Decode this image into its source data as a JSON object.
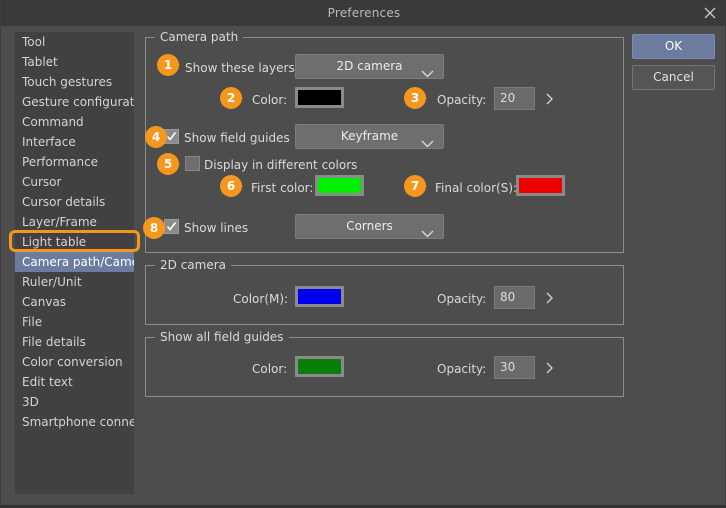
{
  "window": {
    "title": "Preferences",
    "close_icon": "close-icon"
  },
  "buttons": {
    "ok": "OK",
    "cancel": "Cancel"
  },
  "sidebar": {
    "items": [
      {
        "label": "Tool",
        "selected": false
      },
      {
        "label": "Tablet",
        "selected": false
      },
      {
        "label": "Touch gestures",
        "selected": false
      },
      {
        "label": "Gesture configuration",
        "selected": false
      },
      {
        "label": "Command",
        "selected": false
      },
      {
        "label": "Interface",
        "selected": false
      },
      {
        "label": "Performance",
        "selected": false
      },
      {
        "label": "Cursor",
        "selected": false
      },
      {
        "label": "Cursor details",
        "selected": false
      },
      {
        "label": "Layer/Frame",
        "selected": false
      },
      {
        "label": "Light table",
        "selected": false
      },
      {
        "label": "Camera path/Camera",
        "selected": true
      },
      {
        "label": "Ruler/Unit",
        "selected": false
      },
      {
        "label": "Canvas",
        "selected": false
      },
      {
        "label": "File",
        "selected": false
      },
      {
        "label": "File details",
        "selected": false
      },
      {
        "label": "Color conversion",
        "selected": false
      },
      {
        "label": "Edit text",
        "selected": false
      },
      {
        "label": "3D",
        "selected": false
      },
      {
        "label": "Smartphone connection",
        "selected": false
      }
    ],
    "highlight_color": "#f5971d"
  },
  "camera_path": {
    "group_title": "Camera path",
    "show_layers_label": "Show these layers:",
    "show_layers_value": "2D camera",
    "color_label": "Color:",
    "color_value": "#000000",
    "opacity_label": "Opacity:",
    "opacity_value": "20",
    "show_field_guides_label": "Show field guides",
    "show_field_guides_checked": true,
    "field_guides_value": "Keyframe",
    "display_diff_colors_label": "Display in different colors",
    "display_diff_colors_checked": false,
    "first_color_label": "First color:",
    "first_color_value": "#00ee00",
    "final_color_label": "Final color(S):",
    "final_color_value": "#ee0000",
    "show_lines_label": "Show lines",
    "show_lines_checked": true,
    "show_lines_value": "Corners"
  },
  "two_d_camera": {
    "group_title": "2D camera",
    "color_label": "Color(M):",
    "color_value": "#0000ee",
    "opacity_label": "Opacity:",
    "opacity_value": "80"
  },
  "all_field_guides": {
    "group_title": "Show all field guides",
    "color_label": "Color:",
    "color_value": "#0a7d0a",
    "opacity_label": "Opacity:",
    "opacity_value": "30"
  },
  "badges": [
    {
      "n": "1"
    },
    {
      "n": "2"
    },
    {
      "n": "3"
    },
    {
      "n": "4"
    },
    {
      "n": "5"
    },
    {
      "n": "6"
    },
    {
      "n": "7"
    },
    {
      "n": "8"
    }
  ]
}
